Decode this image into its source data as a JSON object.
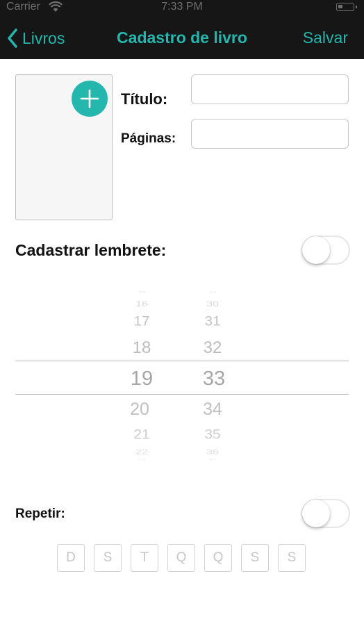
{
  "status_bar": {
    "carrier": "Carrier",
    "time": "7:33 PM"
  },
  "nav": {
    "back_label": "Livros",
    "title": "Cadastro de livro",
    "save_label": "Salvar"
  },
  "form": {
    "title_label": "Título:",
    "title_value": "",
    "pages_label": "Páginas:",
    "pages_value": ""
  },
  "reminder": {
    "label": "Cadastrar lembrete:",
    "enabled": false
  },
  "picker": {
    "hours": [
      "15",
      "16",
      "17",
      "18",
      "19",
      "20",
      "21",
      "22",
      "23"
    ],
    "minutes": [
      "29",
      "30",
      "31",
      "32",
      "33",
      "34",
      "35",
      "36",
      "37"
    ],
    "selected_hour": "19",
    "selected_minute": "33"
  },
  "repeat": {
    "label": "Repetir:",
    "enabled": false,
    "days": [
      "D",
      "S",
      "T",
      "Q",
      "Q",
      "S",
      "S"
    ]
  },
  "colors": {
    "accent": "#23b7ad",
    "nav_background": "#161616"
  }
}
